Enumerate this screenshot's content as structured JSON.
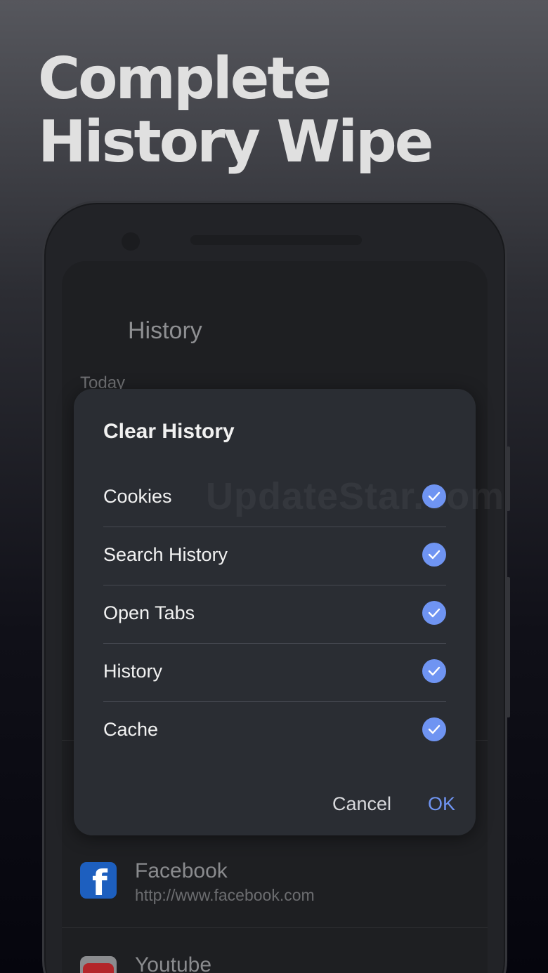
{
  "headline": {
    "line1": "Complete",
    "line2": "History Wipe"
  },
  "screen": {
    "title": "History",
    "section_label": "Today",
    "items": [
      {
        "title": "Facebook",
        "url": "http://www.facebook.com",
        "icon": "facebook-icon"
      },
      {
        "title": "Youtube",
        "url": "",
        "icon": "youtube-icon"
      }
    ]
  },
  "dialog": {
    "title": "Clear History",
    "watermark": "UpdateStar.com",
    "options": [
      {
        "label": "Cookies",
        "checked": true
      },
      {
        "label": "Search History",
        "checked": true
      },
      {
        "label": "Open Tabs",
        "checked": true
      },
      {
        "label": "History",
        "checked": true
      },
      {
        "label": "Cache",
        "checked": true
      }
    ],
    "cancel_label": "Cancel",
    "ok_label": "OK"
  },
  "colors": {
    "accent": "#6f94f2",
    "dialog_bg": "#2a2d33",
    "screen_bg": "#1e1f22"
  }
}
